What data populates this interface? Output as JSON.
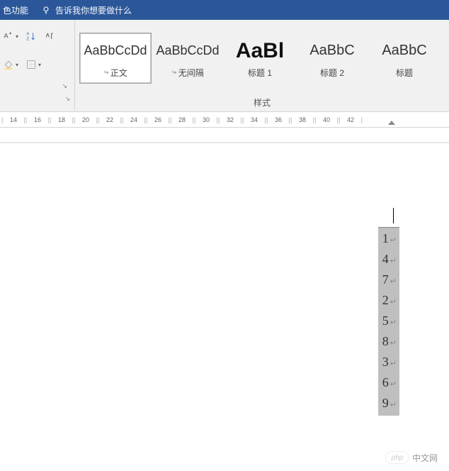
{
  "title_bar": {
    "partial_tab": "色功能",
    "tell_me_placeholder": "告诉我你想要做什么"
  },
  "ribbon": {
    "styles_group_label": "样式",
    "styles": [
      {
        "preview": "AaBbCcDd",
        "name": "正文",
        "selected": true,
        "cls": ""
      },
      {
        "preview": "AaBbCcDd",
        "name": "无间隔",
        "selected": false,
        "cls": ""
      },
      {
        "preview": "AaBl",
        "name": "标题 1",
        "selected": false,
        "cls": "h1"
      },
      {
        "preview": "AaBbC",
        "name": "标题 2",
        "selected": false,
        "cls": "h2"
      },
      {
        "preview": "AaBbC",
        "name": "标题",
        "selected": false,
        "cls": "h3"
      }
    ]
  },
  "ruler": {
    "marks": [
      "14",
      "16",
      "18",
      "20",
      "22",
      "24",
      "26",
      "28",
      "30",
      "32",
      "34",
      "36",
      "38",
      "40",
      "42"
    ]
  },
  "document": {
    "selected_lines": [
      "1",
      "4",
      "7",
      "2",
      "5",
      "8",
      "3",
      "6",
      "9"
    ]
  },
  "watermark": {
    "logo_text": "php",
    "site_text": "中文网"
  }
}
